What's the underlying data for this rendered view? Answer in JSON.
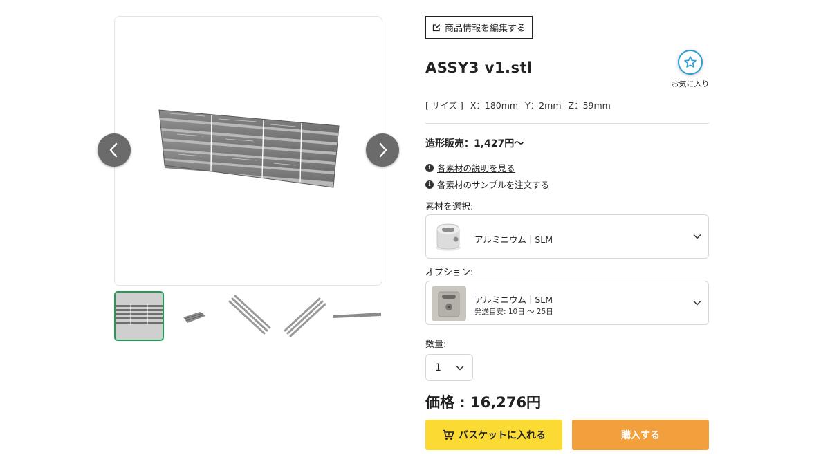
{
  "gallery": {
    "prev_label": "previous-image",
    "next_label": "next-image",
    "thumbnail_count": 5,
    "active_thumbnail": 1
  },
  "product": {
    "edit_button_label": "商品情報を編集する",
    "title": "ASSY3 v1.stl",
    "favorite_label": "お気に入り",
    "size": {
      "label": "[ サイズ ]",
      "x": "X：180mm",
      "y": "Y：2mm",
      "z": "Z：59mm"
    },
    "sale_text": "造形販売：1,427円〜"
  },
  "links": {
    "material_description": "各素材の説明を見る",
    "order_samples": "各素材のサンプルを注文する"
  },
  "material": {
    "label": "素材を選択:",
    "selected": "アルミニウム｜SLM"
  },
  "option": {
    "label": "オプション:",
    "selected": "アルミニウム｜SLM",
    "shipping": "発送目安: 10日 〜 25日"
  },
  "quantity": {
    "label": "数量:",
    "value": "1"
  },
  "price_text": "価格 : 16,276円",
  "buttons": {
    "add_to_basket": "バスケットに入れる",
    "buy_now": "購入する"
  },
  "colors": {
    "accent_green": "#1e9e50",
    "favorite_blue": "#2a9fd6",
    "basket_yellow": "#fbdb33",
    "buy_orange": "#f2a03d"
  },
  "icons": {
    "edit": "edit-icon",
    "favorite": "star-icon",
    "info": "info-icon",
    "cart": "cart-icon",
    "dropdown": "chevron-down-icon"
  }
}
